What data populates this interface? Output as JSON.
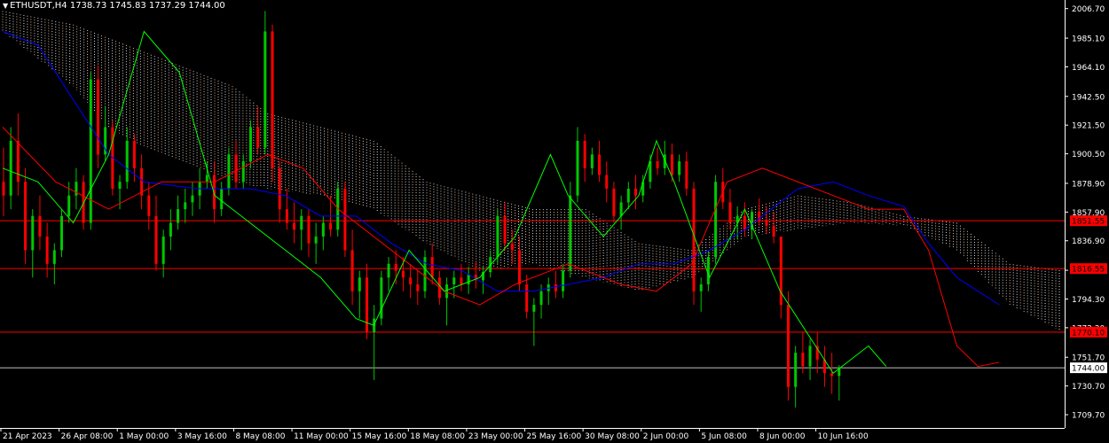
{
  "header": {
    "symbol_label": "ETHUSDT,H4",
    "ohlc_label": "1738.73 1745.83 1737.29 1744.00"
  },
  "colors": {
    "background": "#000000",
    "axis": "#ffffff",
    "bull_candle": "#00c800",
    "bear_candle": "#ff0000",
    "kijun": "#0000ff",
    "tenkan": "#ff0000",
    "chikou": "#00ff00",
    "cloud": "#ffdab9",
    "cloud_alt": "#ffffff",
    "hline": "#ff0000",
    "current_price_line": "#c0c0c0"
  },
  "chart_data": {
    "type": "candlestick",
    "ylim": [
      1700.0,
      2013.0
    ],
    "y_ticks": [
      "2006.70",
      "1985.10",
      "1964.10",
      "1942.50",
      "1921.50",
      "1900.50",
      "1878.90",
      "1857.90",
      "1836.90",
      "1815.30",
      "1794.30",
      "1773.30",
      "1751.70",
      "1730.70",
      "1709.70"
    ],
    "x_ticks": [
      "21 Apr 2023",
      "26 Apr 08:00",
      "1 May 00:00",
      "3 May 16:00",
      "8 May 08:00",
      "11 May 00:00",
      "15 May 16:00",
      "18 May 08:00",
      "23 May 00:00",
      "25 May 16:00",
      "30 May 08:00",
      "2 Jun 00:00",
      "5 Jun 08:00",
      "8 Jun 00:00",
      "10 Jun 16:00"
    ],
    "horizontal_lines": [
      {
        "value": 1851.55,
        "label": "1851.55"
      },
      {
        "value": 1816.55,
        "label": "1816.55"
      },
      {
        "value": 1770.1,
        "label": "1770.10"
      }
    ],
    "current_price": {
      "value": 1744.0,
      "label": "1744.00"
    },
    "candles": [
      [
        1880,
        1905,
        1855,
        1870
      ],
      [
        1870,
        1920,
        1860,
        1910
      ],
      [
        1910,
        1930,
        1870,
        1880
      ],
      [
        1880,
        1890,
        1820,
        1830
      ],
      [
        1830,
        1860,
        1810,
        1855
      ],
      [
        1855,
        1870,
        1830,
        1840
      ],
      [
        1840,
        1850,
        1810,
        1820
      ],
      [
        1820,
        1835,
        1805,
        1830
      ],
      [
        1830,
        1860,
        1825,
        1855
      ],
      [
        1855,
        1880,
        1850,
        1870
      ],
      [
        1870,
        1890,
        1860,
        1880
      ],
      [
        1880,
        1885,
        1845,
        1850
      ],
      [
        1850,
        1960,
        1845,
        1955
      ],
      [
        1955,
        1965,
        1890,
        1900
      ],
      [
        1900,
        1935,
        1895,
        1920
      ],
      [
        1920,
        1925,
        1870,
        1875
      ],
      [
        1875,
        1885,
        1860,
        1880
      ],
      [
        1880,
        1920,
        1875,
        1910
      ],
      [
        1910,
        1915,
        1880,
        1890
      ],
      [
        1890,
        1900,
        1860,
        1870
      ],
      [
        1870,
        1880,
        1845,
        1855
      ],
      [
        1855,
        1870,
        1815,
        1820
      ],
      [
        1820,
        1845,
        1810,
        1840
      ],
      [
        1840,
        1860,
        1830,
        1850
      ],
      [
        1850,
        1870,
        1845,
        1860
      ],
      [
        1860,
        1875,
        1850,
        1865
      ],
      [
        1865,
        1880,
        1855,
        1870
      ],
      [
        1870,
        1890,
        1860,
        1880
      ],
      [
        1880,
        1895,
        1875,
        1885
      ],
      [
        1885,
        1895,
        1850,
        1860
      ],
      [
        1860,
        1880,
        1855,
        1875
      ],
      [
        1875,
        1905,
        1870,
        1900
      ],
      [
        1900,
        1910,
        1875,
        1880
      ],
      [
        1880,
        1900,
        1875,
        1895
      ],
      [
        1895,
        1925,
        1890,
        1920
      ],
      [
        1920,
        1935,
        1900,
        1905
      ],
      [
        1905,
        2005,
        1900,
        1990
      ],
      [
        1990,
        1995,
        1880,
        1890
      ],
      [
        1890,
        1895,
        1850,
        1860
      ],
      [
        1860,
        1875,
        1845,
        1850
      ],
      [
        1850,
        1865,
        1835,
        1845
      ],
      [
        1845,
        1860,
        1830,
        1855
      ],
      [
        1855,
        1860,
        1825,
        1835
      ],
      [
        1835,
        1850,
        1820,
        1840
      ],
      [
        1840,
        1855,
        1830,
        1850
      ],
      [
        1850,
        1870,
        1840,
        1845
      ],
      [
        1845,
        1880,
        1840,
        1875
      ],
      [
        1875,
        1880,
        1825,
        1830
      ],
      [
        1830,
        1845,
        1790,
        1800
      ],
      [
        1800,
        1815,
        1780,
        1810
      ],
      [
        1810,
        1820,
        1765,
        1770
      ],
      [
        1770,
        1790,
        1735,
        1780
      ],
      [
        1780,
        1815,
        1775,
        1810
      ],
      [
        1810,
        1825,
        1800,
        1820
      ],
      [
        1820,
        1830,
        1805,
        1815
      ],
      [
        1815,
        1825,
        1800,
        1810
      ],
      [
        1810,
        1820,
        1795,
        1805
      ],
      [
        1805,
        1815,
        1790,
        1800
      ],
      [
        1800,
        1830,
        1795,
        1825
      ],
      [
        1825,
        1835,
        1805,
        1810
      ],
      [
        1810,
        1815,
        1790,
        1795
      ],
      [
        1795,
        1810,
        1775,
        1805
      ],
      [
        1805,
        1815,
        1795,
        1810
      ],
      [
        1810,
        1820,
        1800,
        1805
      ],
      [
        1805,
        1818,
        1798,
        1812
      ],
      [
        1812,
        1822,
        1802,
        1808
      ],
      [
        1808,
        1818,
        1798,
        1814
      ],
      [
        1814,
        1830,
        1810,
        1825
      ],
      [
        1825,
        1860,
        1820,
        1855
      ],
      [
        1855,
        1865,
        1830,
        1835
      ],
      [
        1835,
        1845,
        1820,
        1830
      ],
      [
        1830,
        1840,
        1800,
        1805
      ],
      [
        1805,
        1812,
        1780,
        1785
      ],
      [
        1785,
        1795,
        1760,
        1790
      ],
      [
        1790,
        1805,
        1780,
        1800
      ],
      [
        1800,
        1810,
        1790,
        1805
      ],
      [
        1805,
        1815,
        1795,
        1800
      ],
      [
        1800,
        1820,
        1795,
        1815
      ],
      [
        1815,
        1880,
        1810,
        1870
      ],
      [
        1870,
        1920,
        1865,
        1910
      ],
      [
        1910,
        1915,
        1880,
        1890
      ],
      [
        1890,
        1905,
        1885,
        1900
      ],
      [
        1900,
        1910,
        1880,
        1885
      ],
      [
        1885,
        1895,
        1865,
        1875
      ],
      [
        1875,
        1880,
        1850,
        1855
      ],
      [
        1855,
        1870,
        1845,
        1865
      ],
      [
        1865,
        1880,
        1860,
        1875
      ],
      [
        1875,
        1885,
        1860,
        1870
      ],
      [
        1870,
        1885,
        1865,
        1880
      ],
      [
        1880,
        1900,
        1875,
        1895
      ],
      [
        1895,
        1905,
        1885,
        1890
      ],
      [
        1890,
        1910,
        1885,
        1900
      ],
      [
        1900,
        1908,
        1880,
        1885
      ],
      [
        1885,
        1900,
        1880,
        1895
      ],
      [
        1895,
        1902,
        1870,
        1875
      ],
      [
        1875,
        1880,
        1790,
        1800
      ],
      [
        1800,
        1810,
        1785,
        1805
      ],
      [
        1805,
        1830,
        1800,
        1825
      ],
      [
        1825,
        1885,
        1820,
        1880
      ],
      [
        1880,
        1890,
        1860,
        1865
      ],
      [
        1865,
        1875,
        1845,
        1850
      ],
      [
        1850,
        1862,
        1838,
        1855
      ],
      [
        1855,
        1865,
        1840,
        1845
      ],
      [
        1845,
        1860,
        1838,
        1858
      ],
      [
        1858,
        1868,
        1848,
        1852
      ],
      [
        1852,
        1862,
        1842,
        1848
      ],
      [
        1848,
        1858,
        1835,
        1840
      ],
      [
        1840,
        1815,
        1780,
        1790
      ],
      [
        1790,
        1800,
        1720,
        1730
      ],
      [
        1730,
        1760,
        1715,
        1755
      ],
      [
        1755,
        1770,
        1740,
        1745
      ],
      [
        1745,
        1765,
        1735,
        1760
      ],
      [
        1760,
        1770,
        1740,
        1750
      ],
      [
        1750,
        1760,
        1730,
        1740
      ],
      [
        1740,
        1755,
        1725,
        1738
      ],
      [
        1738,
        1746,
        1720,
        1744
      ]
    ],
    "kijun": [
      [
        0,
        1990
      ],
      [
        10,
        1980
      ],
      [
        20,
        1940
      ],
      [
        30,
        1900
      ],
      [
        40,
        1880
      ],
      [
        55,
        1875
      ],
      [
        70,
        1875
      ],
      [
        80,
        1870
      ],
      [
        90,
        1855
      ],
      [
        100,
        1855
      ],
      [
        110,
        1835
      ],
      [
        120,
        1820
      ],
      [
        130,
        1815
      ],
      [
        140,
        1800
      ],
      [
        150,
        1800
      ],
      [
        160,
        1805
      ],
      [
        170,
        1810
      ],
      [
        180,
        1820
      ],
      [
        190,
        1820
      ],
      [
        200,
        1830
      ],
      [
        210,
        1845
      ],
      [
        215,
        1855
      ],
      [
        225,
        1875
      ],
      [
        235,
        1880
      ],
      [
        245,
        1870
      ],
      [
        255,
        1862
      ],
      [
        262,
        1835
      ],
      [
        270,
        1810
      ],
      [
        276,
        1800
      ],
      [
        282,
        1790
      ]
    ],
    "tenkan": [
      [
        0,
        1920
      ],
      [
        15,
        1880
      ],
      [
        30,
        1860
      ],
      [
        45,
        1880
      ],
      [
        60,
        1880
      ],
      [
        75,
        1900
      ],
      [
        85,
        1890
      ],
      [
        95,
        1860
      ],
      [
        105,
        1840
      ],
      [
        115,
        1820
      ],
      [
        125,
        1800
      ],
      [
        135,
        1790
      ],
      [
        145,
        1805
      ],
      [
        160,
        1820
      ],
      [
        175,
        1805
      ],
      [
        185,
        1800
      ],
      [
        195,
        1820
      ],
      [
        205,
        1880
      ],
      [
        215,
        1890
      ],
      [
        225,
        1880
      ],
      [
        235,
        1870
      ],
      [
        245,
        1860
      ],
      [
        255,
        1860
      ],
      [
        262,
        1830
      ],
      [
        270,
        1760
      ],
      [
        276,
        1745
      ],
      [
        282,
        1748
      ]
    ],
    "chikou": [
      [
        0,
        1890
      ],
      [
        10,
        1880
      ],
      [
        20,
        1850
      ],
      [
        30,
        1900
      ],
      [
        40,
        1990
      ],
      [
        50,
        1960
      ],
      [
        60,
        1870
      ],
      [
        70,
        1850
      ],
      [
        80,
        1830
      ],
      [
        90,
        1810
      ],
      [
        100,
        1780
      ],
      [
        105,
        1775
      ],
      [
        115,
        1830
      ],
      [
        125,
        1800
      ],
      [
        135,
        1810
      ],
      [
        145,
        1840
      ],
      [
        155,
        1900
      ],
      [
        160,
        1870
      ],
      [
        170,
        1840
      ],
      [
        180,
        1870
      ],
      [
        185,
        1910
      ],
      [
        190,
        1880
      ],
      [
        200,
        1810
      ],
      [
        210,
        1860
      ],
      [
        220,
        1800
      ],
      [
        230,
        1760
      ],
      [
        235,
        1740
      ],
      [
        245,
        1760
      ],
      [
        250,
        1745
      ]
    ],
    "cloud": [
      [
        0,
        2005,
        1990
      ],
      [
        20,
        1995,
        1950
      ],
      [
        30,
        1985,
        1920
      ],
      [
        40,
        1975,
        1905
      ],
      [
        55,
        1960,
        1890
      ],
      [
        65,
        1950,
        1880
      ],
      [
        75,
        1930,
        1875
      ],
      [
        90,
        1920,
        1870
      ],
      [
        105,
        1910,
        1860
      ],
      [
        120,
        1880,
        1835
      ],
      [
        135,
        1870,
        1815
      ],
      [
        150,
        1860,
        1820
      ],
      [
        165,
        1860,
        1810
      ],
      [
        180,
        1835,
        1800
      ],
      [
        195,
        1830,
        1810
      ],
      [
        210,
        1860,
        1840
      ],
      [
        225,
        1870,
        1845
      ],
      [
        240,
        1865,
        1850
      ],
      [
        255,
        1855,
        1848
      ],
      [
        270,
        1850,
        1830
      ],
      [
        285,
        1820,
        1790
      ],
      [
        300,
        1815,
        1770
      ]
    ]
  }
}
